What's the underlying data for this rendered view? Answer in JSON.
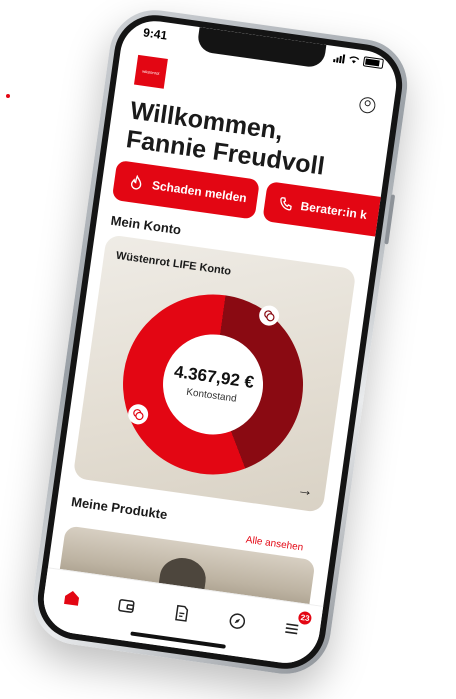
{
  "status": {
    "time": "9:41"
  },
  "brand": {
    "logo_text": "wüstenrot",
    "accent": "#e30613",
    "dark_accent": "#8a0a12"
  },
  "header": {
    "greeting_line1": "Willkommen,",
    "greeting_line2": "Fannie Freudvoll",
    "profile_icon": "user-circle-icon"
  },
  "actions": [
    {
      "label": "Schaden melden",
      "icon": "flame-icon"
    },
    {
      "label": "Berater:in k",
      "icon": "phone-icon"
    }
  ],
  "account": {
    "section_title": "Mein Konto",
    "card_title": "Wüstenrot LIFE Konto",
    "amount": "4.367,92 €",
    "amount_label": "Kontostand",
    "ring_share_dark": 0.42
  },
  "products": {
    "section_title": "Meine Produkte",
    "all_link": "Alle ansehen"
  },
  "tabbar": {
    "items": [
      {
        "name": "home-icon",
        "active": true
      },
      {
        "name": "wallet-icon",
        "active": false
      },
      {
        "name": "document-icon",
        "active": false
      },
      {
        "name": "compass-icon",
        "active": false
      },
      {
        "name": "menu-icon",
        "active": false
      }
    ],
    "menu_badge": "23"
  }
}
